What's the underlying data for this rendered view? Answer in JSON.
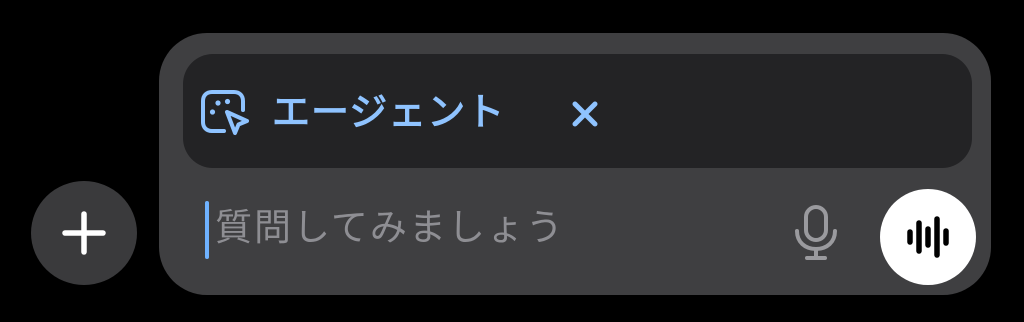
{
  "colors": {
    "page_background": "#000000",
    "composer_background": "#3f3f41",
    "agent_card_background": "#232325",
    "plus_button_background": "#3a3a3c",
    "accent_blue": "#8fc3ff",
    "caret": "#6fb2ff",
    "placeholder_text": "#8e8e93",
    "icon_gray": "#9a9a9e",
    "voice_button_background": "#ffffff",
    "voice_icon": "#000000"
  },
  "buttons": {
    "plus": {
      "icon": "plus-icon"
    },
    "mic": {
      "icon": "microphone-icon"
    },
    "voice": {
      "icon": "voice-waveform-icon"
    }
  },
  "agent": {
    "label": "エージェント",
    "icon": "agent-cursor-icon",
    "close_icon": "close-icon"
  },
  "input": {
    "placeholder": "質問してみましょう",
    "value": ""
  }
}
